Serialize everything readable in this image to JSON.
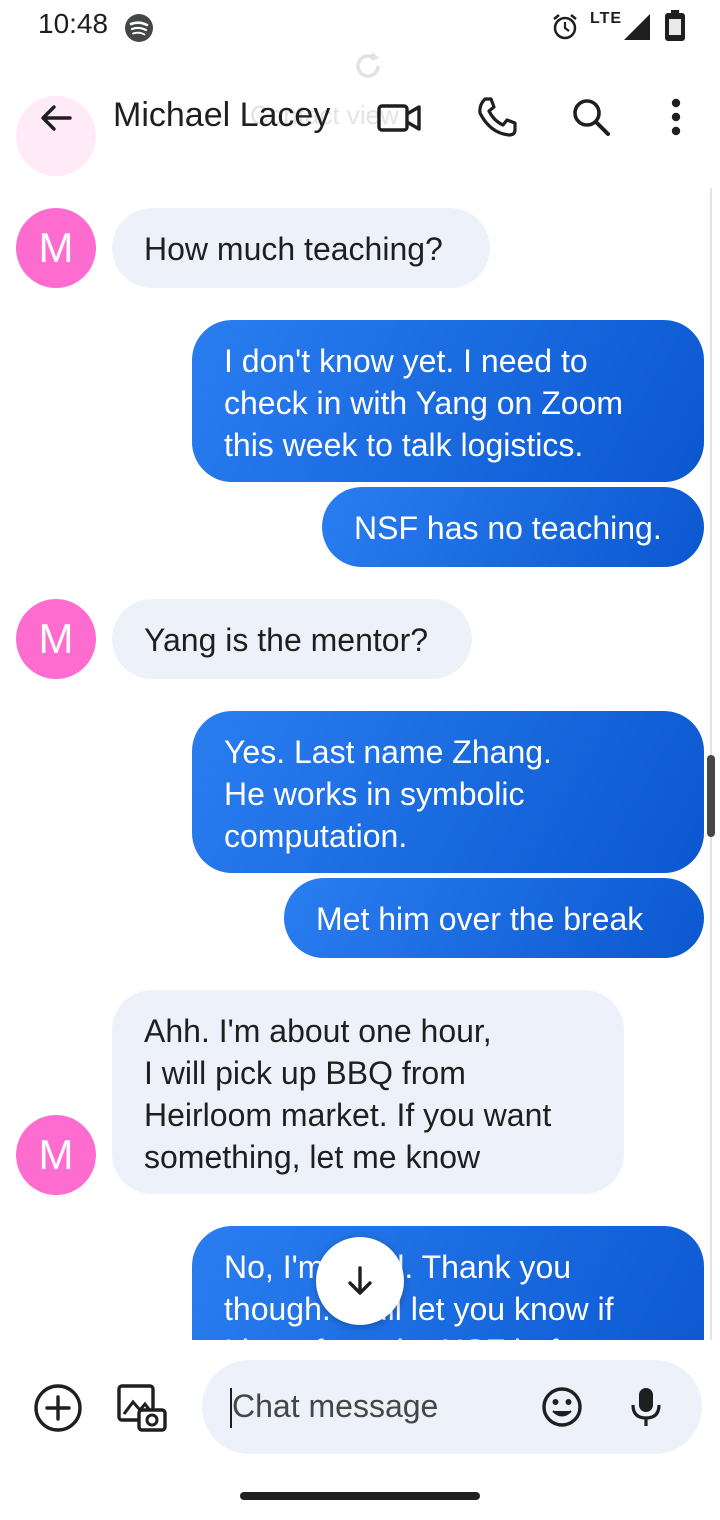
{
  "status_bar": {
    "time": "10:48",
    "network": "LTE",
    "icons": [
      "spotify-icon",
      "alarm-icon",
      "signal-icon",
      "battery-icon"
    ]
  },
  "header": {
    "contact_name": "Michael Lacey",
    "background_text": "Contact view",
    "actions": [
      "back-arrow-icon",
      "video-call-icon",
      "phone-icon",
      "search-icon",
      "more-vert-icon"
    ]
  },
  "messages": [
    {
      "direction": "incoming",
      "avatar": "M",
      "text": "How much teaching?"
    },
    {
      "direction": "outgoing",
      "text": "I don't know yet. I need to\ncheck in with Yang on Zoom\nthis week to talk logistics."
    },
    {
      "direction": "outgoing",
      "text": "NSF has no teaching."
    },
    {
      "direction": "incoming",
      "avatar": "M",
      "text": "Yang is the mentor?"
    },
    {
      "direction": "outgoing",
      "text": "Yes. Last name Zhang.\nHe works in symbolic\ncomputation."
    },
    {
      "direction": "outgoing",
      "text": "Met him over the break"
    },
    {
      "direction": "incoming",
      "avatar": "M",
      "text": "Ahh. I'm about one hour,\nI will pick up BBQ from\nHeirloom market. If you want\nsomething, let me know"
    },
    {
      "direction": "outgoing",
      "text": "No, I'm good. Thank you\nthough. I will let you know if\nI hear from the NSF before"
    }
  ],
  "composer": {
    "placeholder": "Chat message",
    "buttons": [
      "add-icon",
      "gallery-camera-icon",
      "emoji-icon",
      "microphone-icon"
    ]
  },
  "scroll_down_button": "arrow-down-icon",
  "colors": {
    "incoming_bubble": "#edf2fa",
    "outgoing_bubble": "#1a6ddf",
    "avatar": "#ff6ccf",
    "text": "#1f1f1f"
  }
}
